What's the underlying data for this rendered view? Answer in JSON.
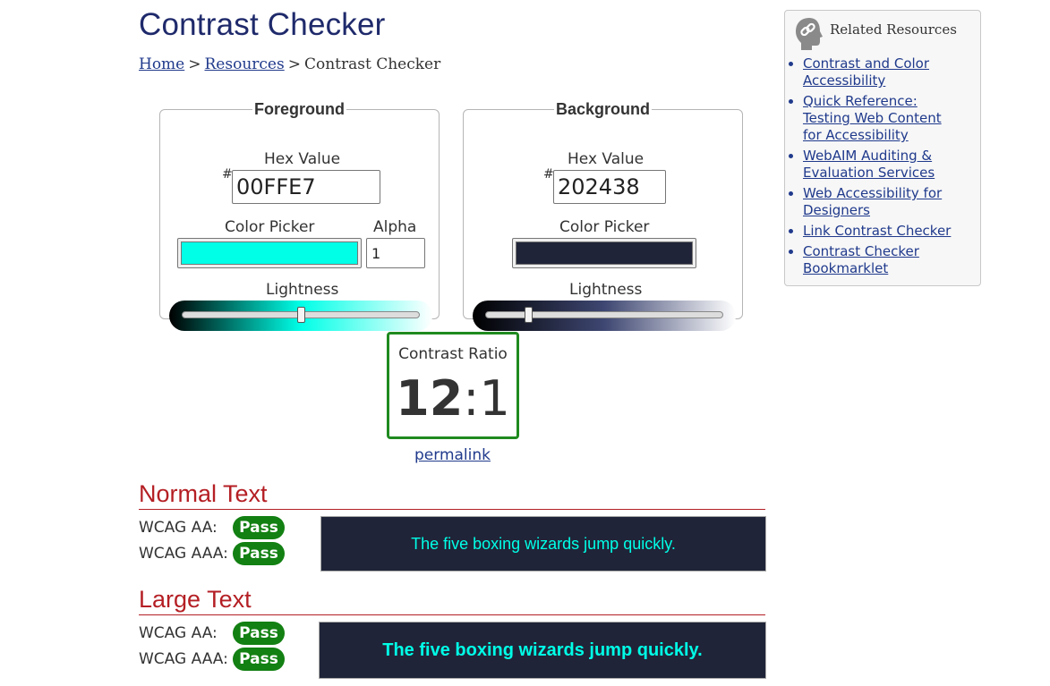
{
  "page": {
    "title": "Contrast Checker"
  },
  "breadcrumb": {
    "home": "Home",
    "resources": "Resources",
    "current": "Contrast Checker",
    "separator": ">"
  },
  "foreground": {
    "legend": "Foreground",
    "hex_label": "Hex Value",
    "hash": "#",
    "hex_value": "00FFE7",
    "picker_label": "Color Picker",
    "alpha_label": "Alpha",
    "alpha_value": "1",
    "lightness_label": "Lightness",
    "lightness_level": 0.5,
    "color": "#00FFE7"
  },
  "background": {
    "legend": "Background",
    "hex_label": "Hex Value",
    "hash": "#",
    "hex_value": "202438",
    "picker_label": "Color Picker",
    "lightness_label": "Lightness",
    "lightness_level": 0.18,
    "color": "#202438"
  },
  "contrast": {
    "label": "Contrast Ratio",
    "ratio_main": "12",
    "ratio_rest": ":1",
    "permalink": "permalink",
    "box_color": "#1f8a1f"
  },
  "normal_text": {
    "title": "Normal Text",
    "aa_label": "WCAG AA:",
    "aa_result": "Pass",
    "aaa_label": "WCAG AAA:",
    "aaa_result": "Pass",
    "sample": "The five boxing wizards jump quickly."
  },
  "large_text": {
    "title": "Large Text",
    "aa_label": "WCAG AA:",
    "aa_result": "Pass",
    "aaa_label": "WCAG AAA:",
    "aaa_result": "Pass",
    "sample": "The five boxing wizards jump quickly."
  },
  "sidebar": {
    "title": "Related Resources",
    "icon": "link-icon",
    "items": [
      "Contrast and Color Accessibility",
      "Quick Reference: Testing Web Content for Accessibility",
      "WebAIM Auditing & Evaluation Services",
      "Web Accessibility for Designers",
      "Link Contrast Checker",
      "Contrast Checker Bookmarklet"
    ]
  },
  "colors": {
    "heading": "#1f2a6b",
    "link": "#203a8c",
    "section": "#b41f24",
    "pass": "#128012"
  }
}
